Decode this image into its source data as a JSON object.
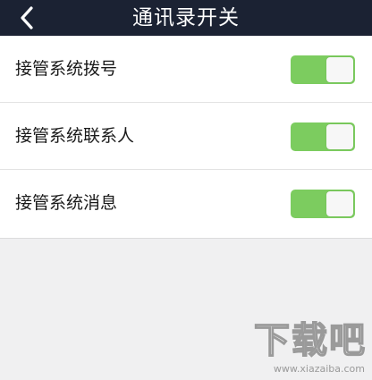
{
  "header": {
    "title": "通讯录开关",
    "back_icon": "chevron-left-icon"
  },
  "settings": [
    {
      "label": "接管系统拨号",
      "enabled": true
    },
    {
      "label": "接管系统联系人",
      "enabled": true
    },
    {
      "label": "接管系统消息",
      "enabled": true
    }
  ],
  "colors": {
    "navbar": "#1b2233",
    "toggle_on": "#7ccc5f",
    "background": "#f0f0f1"
  },
  "watermark": {
    "logo": "下载吧",
    "url": "www.xiazaiba.com"
  }
}
